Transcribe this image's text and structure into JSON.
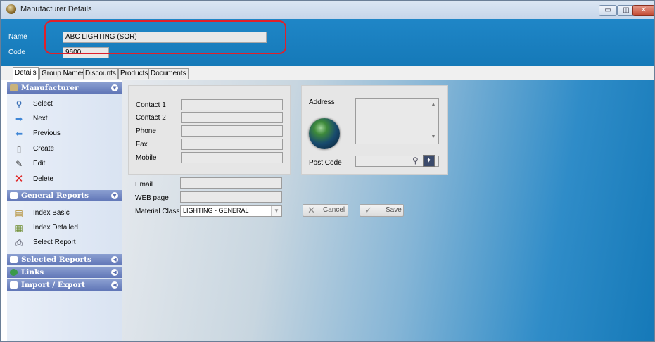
{
  "window": {
    "title": "Manufacturer Details",
    "minimize_label": "▭",
    "maximize_label": "◫",
    "close_label": "✕"
  },
  "header": {
    "name_label": "Name",
    "name_value": "ABC LIGHTING (SOR)",
    "code_label": "Code",
    "code_value": "9600"
  },
  "tabs": [
    "Details",
    "Group Names",
    "Discounts",
    "Products",
    "Documents"
  ],
  "sidebar": {
    "manufacturer": {
      "title": "Manufacturer",
      "items": [
        {
          "label": "Select",
          "icon": "magnifier-icon"
        },
        {
          "label": "Next",
          "icon": "arrow-right-icon"
        },
        {
          "label": "Previous",
          "icon": "arrow-left-icon"
        },
        {
          "label": "Create",
          "icon": "blank-page-icon"
        },
        {
          "label": "Edit",
          "icon": "pencil-icon"
        },
        {
          "label": "Delete",
          "icon": "red-x-icon"
        }
      ]
    },
    "general_reports": {
      "title": "General Reports",
      "items": [
        {
          "label": "Index Basic",
          "icon": "report-icon"
        },
        {
          "label": "Index Detailed",
          "icon": "report-detail-icon"
        },
        {
          "label": "Select Report",
          "icon": "printer-icon"
        }
      ]
    },
    "selected_reports": {
      "title": "Selected Reports"
    },
    "links": {
      "title": "Links"
    },
    "import_export": {
      "title": "Import / Export"
    }
  },
  "contact_panel": {
    "contact1_label": "Contact 1",
    "contact2_label": "Contact 2",
    "phone_label": "Phone",
    "fax_label": "Fax",
    "mobile_label": "Mobile"
  },
  "address_panel": {
    "address_label": "Address",
    "postcode_label": "Post Code"
  },
  "extra_fields": {
    "email_label": "Email",
    "web_label": "WEB page",
    "material_label": "Material Class",
    "material_value": "LIGHTING - GENERAL"
  },
  "actions": {
    "cancel_label": "Cancel",
    "save_label": "Save"
  },
  "colors": {
    "header_blue": "#1f86c7",
    "group_header": "#6f84c2",
    "highlight_red": "#e0202a"
  }
}
